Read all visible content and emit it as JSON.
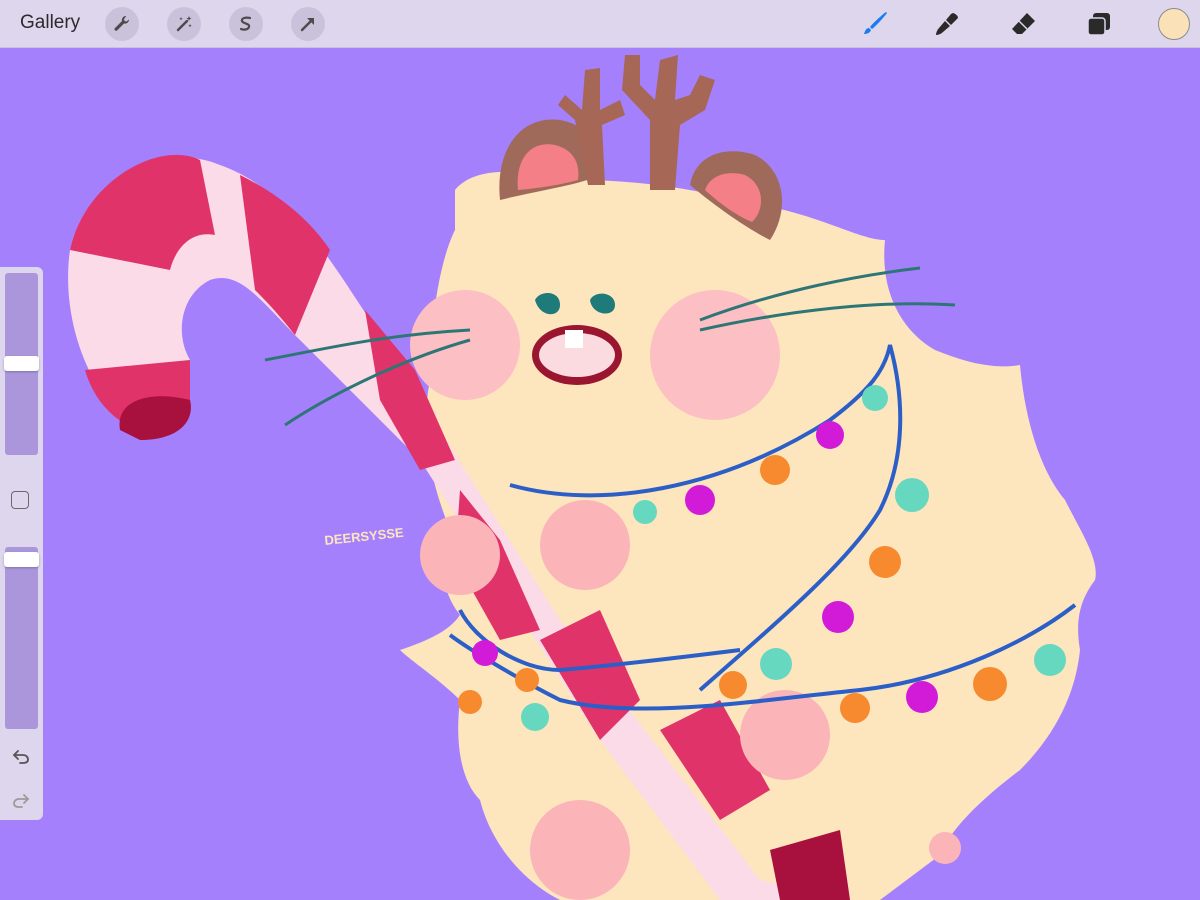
{
  "topbar": {
    "gallery_label": "Gallery",
    "left_tools": [
      {
        "icon": "wrench-icon"
      },
      {
        "icon": "magic-wand-icon"
      },
      {
        "icon": "selection-s-icon"
      },
      {
        "icon": "transform-arrow-icon"
      }
    ],
    "right_tools": [
      {
        "icon": "brush-icon",
        "active": true,
        "color": "#1a7cf0"
      },
      {
        "icon": "smudge-icon"
      },
      {
        "icon": "eraser-icon"
      },
      {
        "icon": "layers-icon"
      }
    ],
    "current_color": "#fbe1b7"
  },
  "sidebar": {
    "brush_size_level": 0.2,
    "opacity_level": 0.03,
    "modify_icon": "modify-square-icon",
    "undo_icon": "undo-icon",
    "redo_icon": "redo-icon"
  },
  "canvas": {
    "background": "#a580fc",
    "signature_text": "DEERSYSSE"
  }
}
